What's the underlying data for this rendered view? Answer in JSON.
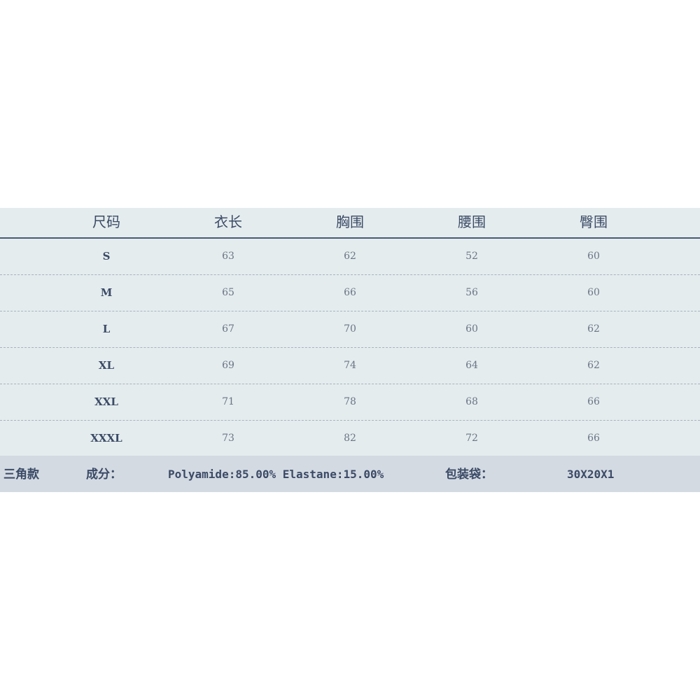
{
  "table": {
    "headers": [
      "尺码",
      "衣长",
      "胸围",
      "腰围",
      "臀围"
    ],
    "rows": [
      [
        "S",
        "63",
        "62",
        "52",
        "60"
      ],
      [
        "M",
        "65",
        "66",
        "56",
        "60"
      ],
      [
        "L",
        "67",
        "70",
        "60",
        "62"
      ],
      [
        "XL",
        "69",
        "74",
        "64",
        "62"
      ],
      [
        "XXL",
        "71",
        "78",
        "68",
        "66"
      ],
      [
        "XXXL",
        "73",
        "82",
        "72",
        "66"
      ]
    ]
  },
  "footer": {
    "style": "三角款",
    "composition_label": "成分：",
    "composition_value": "Polyamide:85.00% Elastane:15.00%",
    "bag_label": "包装袋：",
    "bag_value": "30X20X1"
  },
  "colors": {
    "table_bg": "#e4ecee",
    "footer_bg": "#d3dae2",
    "text": "#3b4a66",
    "rule": "#4a5a78"
  }
}
